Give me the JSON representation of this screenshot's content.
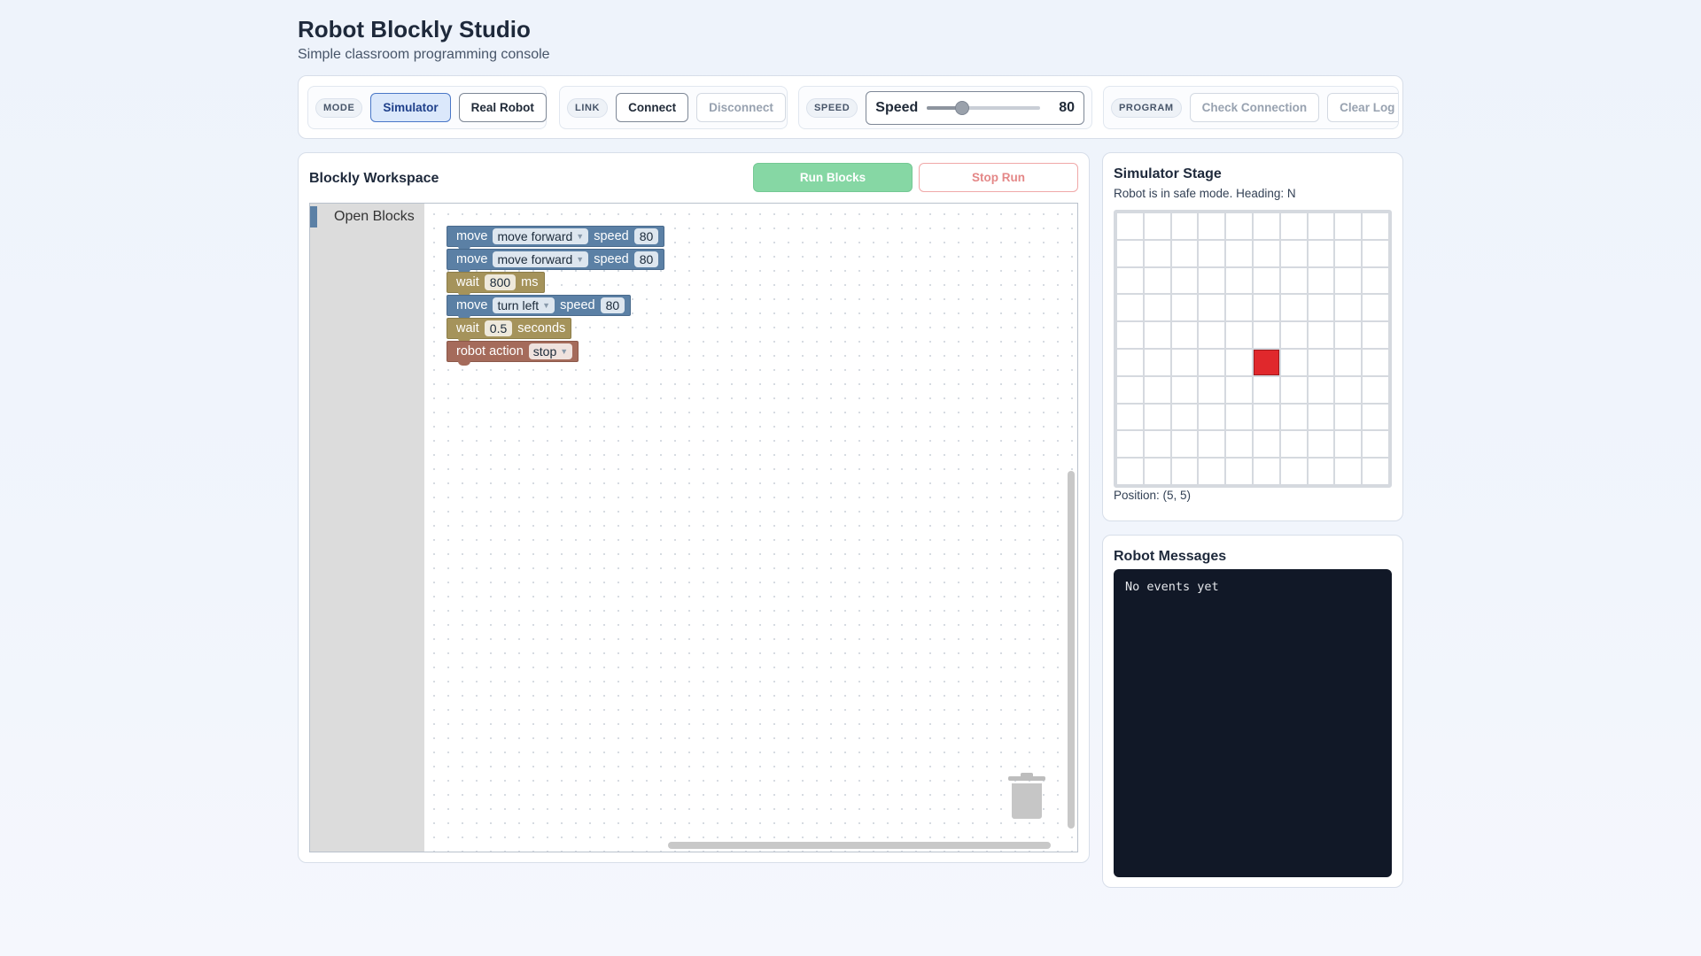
{
  "header": {
    "title": "Robot Blockly Studio",
    "subtitle": "Simple classroom programming console"
  },
  "toolbar": {
    "mode": {
      "chip": "MODE",
      "simulator_label": "Simulator",
      "real_robot_label": "Real Robot",
      "selected": "Simulator"
    },
    "link": {
      "chip": "LINK",
      "connect_label": "Connect",
      "disconnect_label": "Disconnect"
    },
    "speed": {
      "chip": "SPEED",
      "label": "Speed",
      "value": "80",
      "min": 0,
      "max": 255,
      "level": 80
    },
    "program": {
      "chip": "PROGRAM",
      "check_label": "Check Connection",
      "clear_label": "Clear Log"
    }
  },
  "workspace": {
    "title": "Blockly Workspace",
    "run_label": "Run Blocks",
    "stop_label": "Stop Run",
    "toolbox_category": "Open Blocks",
    "blocks": [
      {
        "kind": "move",
        "prefix": "move",
        "option": "move forward",
        "mid": "speed",
        "value": "80"
      },
      {
        "kind": "move",
        "prefix": "move",
        "option": "move forward",
        "mid": "speed",
        "value": "80"
      },
      {
        "kind": "wait",
        "prefix": "wait",
        "value": "800",
        "suffix": "ms"
      },
      {
        "kind": "move",
        "prefix": "move",
        "option": "turn left",
        "mid": "speed",
        "value": "80"
      },
      {
        "kind": "wait",
        "prefix": "wait",
        "value": "0.5",
        "suffix": "seconds"
      },
      {
        "kind": "action",
        "prefix": "robot action",
        "option": "stop"
      }
    ],
    "colors": {
      "move": "#5b80a5",
      "wait": "#a5935b",
      "action": "#a56b5b"
    }
  },
  "simulator": {
    "title": "Simulator Stage",
    "status": "Robot is in safe mode. Heading: N",
    "grid_size": 10,
    "robot": {
      "col": 5,
      "row": 5,
      "color": "#e0282c"
    },
    "position_text": "Position: (5, 5)"
  },
  "messages": {
    "title": "Robot Messages",
    "log": "No events yet"
  }
}
